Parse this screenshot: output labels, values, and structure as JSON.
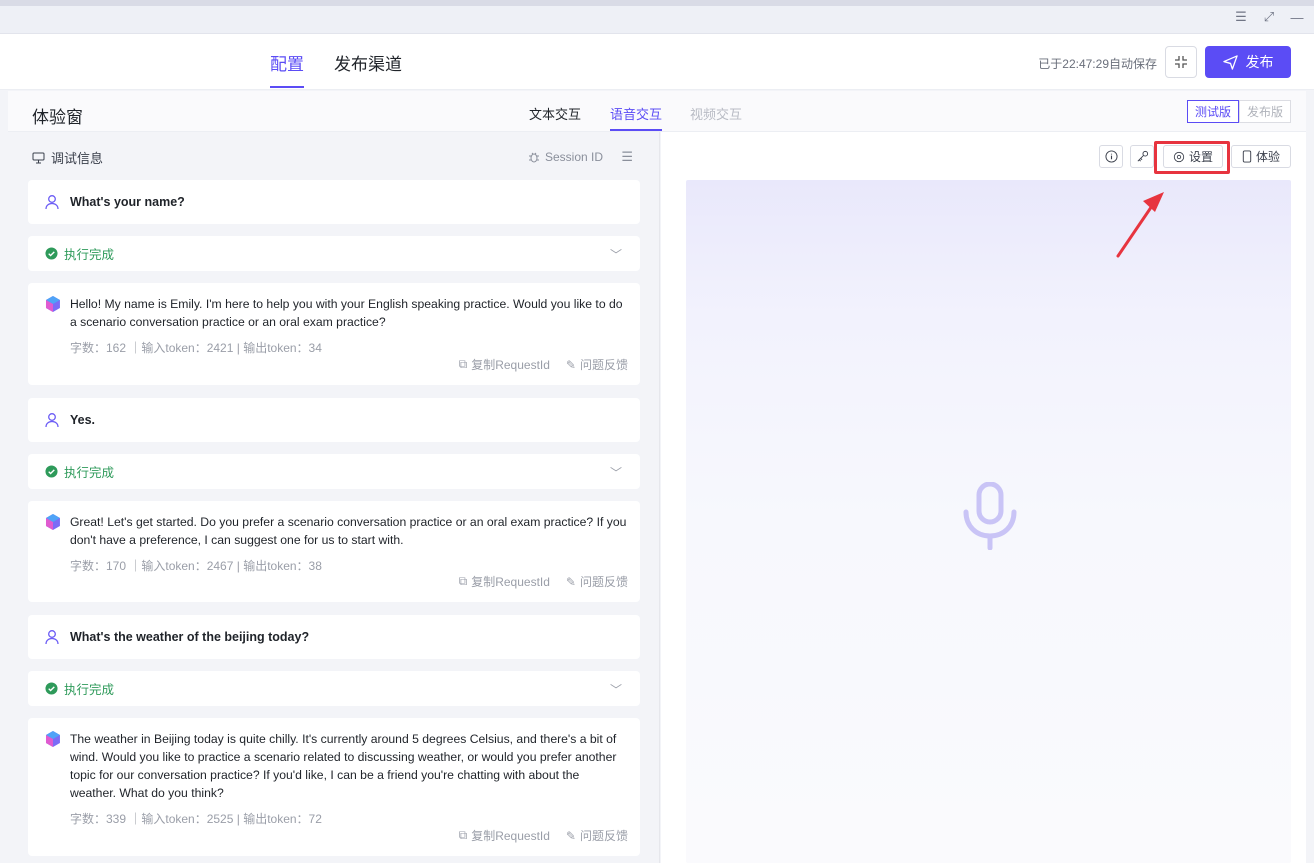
{
  "header": {
    "tabs": [
      {
        "label": "配置",
        "active": true
      },
      {
        "label": "发布渠道",
        "active": false
      }
    ],
    "autosave": "已于22:47:29自动保存",
    "publish_label": "发布"
  },
  "subheader": {
    "title": "体验窗",
    "tabs": [
      {
        "label": "文本交互"
      },
      {
        "label": "语音交互"
      },
      {
        "label": "视频交互"
      }
    ],
    "versions": [
      "测试版",
      "发布版"
    ]
  },
  "debug": {
    "title": "调试信息",
    "session": "Session ID"
  },
  "conversation": [
    {
      "user": "What's your name?",
      "status": "执行完成",
      "reply": "Hello! My name is Emily. I'm here to help you with your English speaking practice. Would you like to do a scenario conversation practice or an oral exam practice?",
      "stats": "字数：162 ｜输入token：2421 | 输出token：34"
    },
    {
      "user": "Yes.",
      "status": "执行完成",
      "reply": "Great! Let's get started. Do you prefer a scenario conversation practice or an oral exam practice? If you don't have a preference, I can suggest one for us to start with.",
      "stats": "字数：170 ｜输入token：2467 | 输出token：38"
    },
    {
      "user": "What's the weather of the beijing today?",
      "status": "执行完成",
      "reply": "The weather in Beijing today is quite chilly. It's currently around 5 degrees Celsius, and there's a bit of wind. Would you like to practice a scenario related to discussing weather, or would you prefer another topic for our conversation practice? If you'd like, I can be a friend you're chatting with about the weather. What do you think?",
      "stats": "字数：339 ｜输入token：2525 | 输出token：72"
    }
  ],
  "actions": {
    "copy": "复制RequestId",
    "feedback": "问题反馈"
  },
  "right": {
    "settings_label": "设置",
    "experience_label": "体验"
  },
  "colors": {
    "accent": "#5b4cf5",
    "success": "#2e9a5a",
    "highlight": "#e7343f"
  }
}
